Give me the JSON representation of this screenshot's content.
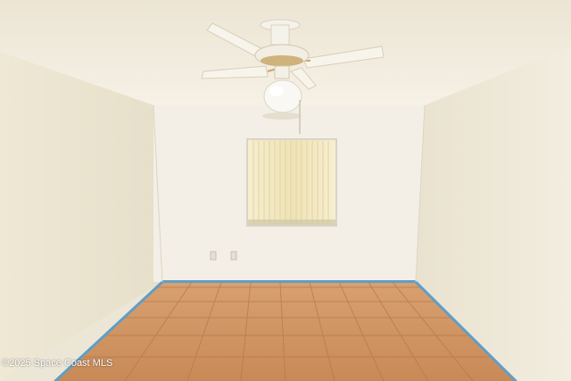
{
  "scene": {
    "subject": "empty room",
    "watermark": "©2025 Space Coast MLS",
    "colors": {
      "ceiling": "#f0eadc",
      "left_wall": "#ece5d2",
      "back_wall": "#f2eee6",
      "right_wall": "#efe9db",
      "baseboard": "#5f9ec7",
      "floor_tile": "#c98e5c",
      "grout": "#b07a4d",
      "blinds": "#f1e8c4",
      "fan_white": "#f7f4ec",
      "fan_brass": "#c9a86a"
    }
  }
}
